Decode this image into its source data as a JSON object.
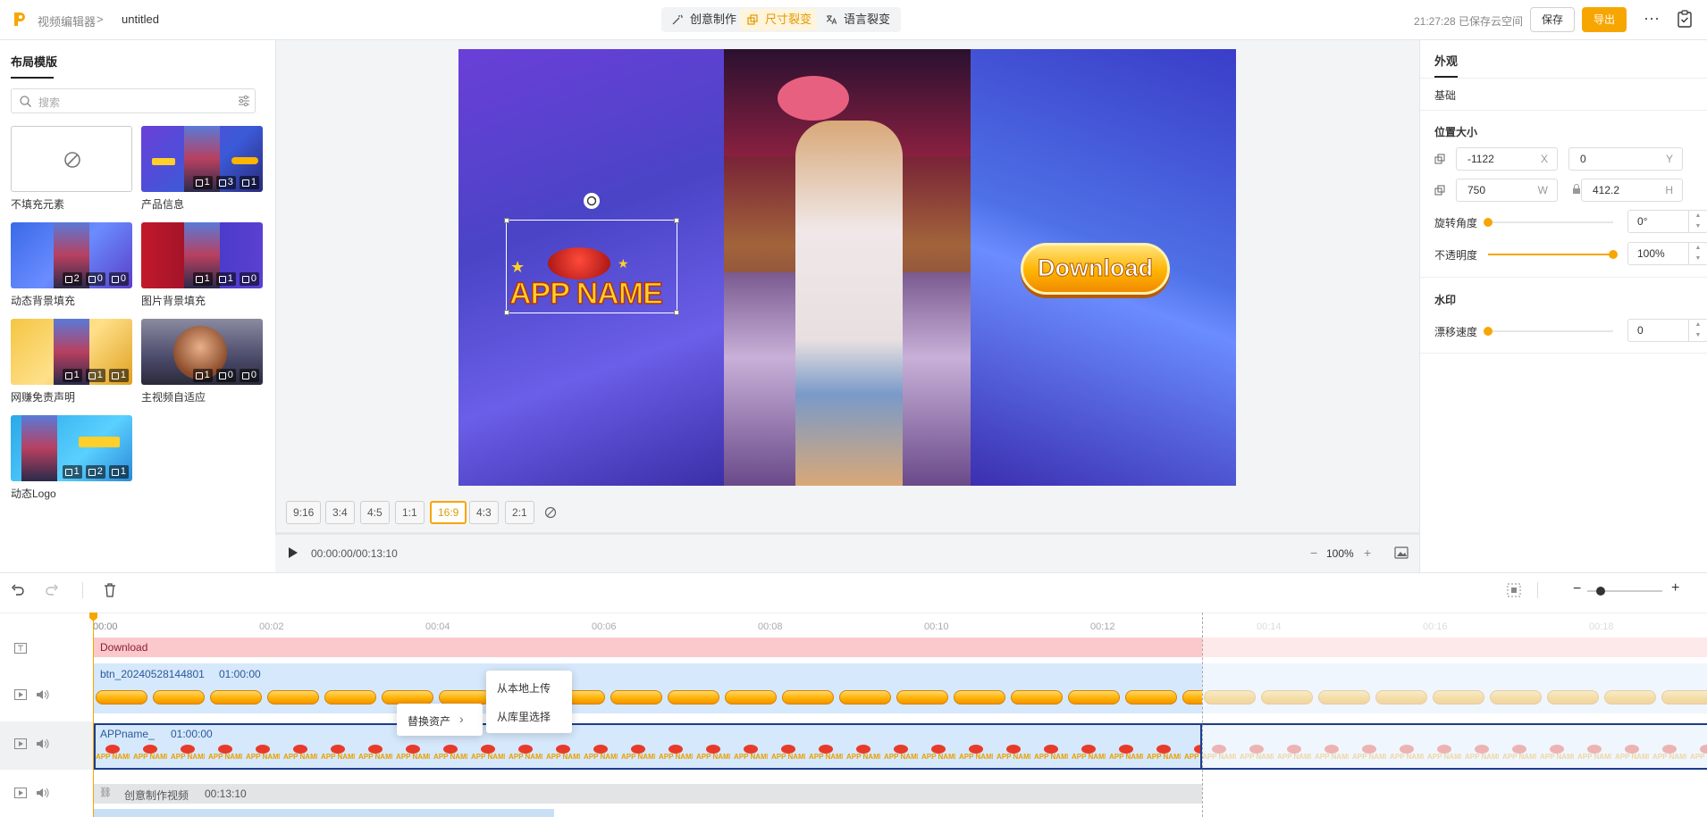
{
  "header": {
    "breadcrumb_app": "视频编辑器",
    "breadcrumb_sep": ">",
    "project_name": "untitled",
    "modes": [
      {
        "label": "创意制作",
        "icon": "wand-icon"
      },
      {
        "label": "尺寸裂变",
        "icon": "resize-icon"
      },
      {
        "label": "语言裂变",
        "icon": "translate-icon"
      }
    ],
    "active_mode": "尺寸裂变",
    "save_status": "21:27:28 已保存云空间",
    "save_label": "保存",
    "export_label": "导出",
    "more_label": "···"
  },
  "left_panel": {
    "tab": "布局模版",
    "search_placeholder": "搜索",
    "templates": [
      {
        "name": "不填充元素",
        "badges": []
      },
      {
        "name": "产品信息",
        "badges": [
          "1",
          "3",
          "1"
        ]
      },
      {
        "name": "动态背景填充",
        "badges": [
          "2",
          "0",
          "0"
        ]
      },
      {
        "name": "图片背景填充",
        "badges": [
          "1",
          "1",
          "0"
        ]
      },
      {
        "name": "网赚免责声明",
        "badges": [
          "1",
          "1",
          "1"
        ]
      },
      {
        "name": "主视频自适应",
        "badges": [
          "1",
          "0",
          "0"
        ]
      },
      {
        "name": "动态Logo",
        "badges": [
          "1",
          "2",
          "1"
        ]
      }
    ]
  },
  "canvas": {
    "logo_text": "APP NAME",
    "download_text": "Download",
    "ratios": [
      "9:16",
      "3:4",
      "4:5",
      "1:1",
      "16:9",
      "4:3",
      "2:1"
    ],
    "active_ratio": "16:9",
    "timecode": "00:00:00/00:13:10",
    "zoom": "100%",
    "zoom_minus": "−",
    "zoom_plus": "+"
  },
  "right_panel": {
    "tab": "外观",
    "section_basic": "基础",
    "section_position": "位置大小",
    "x_value": "-1122",
    "x_label": "X",
    "y_value": "0",
    "y_label": "Y",
    "w_value": "750",
    "w_label": "W",
    "h_value": "412.2",
    "h_label": "H",
    "rotation_label": "旋转角度",
    "rotation_value": "0°",
    "rotation_level": 0,
    "opacity_label": "不透明度",
    "opacity_value": "100%",
    "opacity_level": 1.0,
    "section_watermark": "水印",
    "drift_label": "漂移速度",
    "drift_value": "0",
    "drift_level": 0,
    "accent_color": "#f7a600"
  },
  "timeline": {
    "ticks": [
      "00:00",
      "00:02",
      "00:04",
      "00:06",
      "00:08",
      "00:10",
      "00:12",
      "00:14",
      "00:16",
      "00:18"
    ],
    "text_track_label": "Download",
    "button_track_name": "btn_20240528144801",
    "button_track_duration": "01:00:00",
    "logo_track_name": "APPname_",
    "logo_track_duration": "01:00:00",
    "main_track_label": "创意制作视频",
    "main_track_duration": "00:13:10",
    "context_menu_replace": "替换资产",
    "context_menu_upload": "从本地上传",
    "context_menu_library": "从库里选择",
    "logo_chip_text": "APP NAME"
  }
}
